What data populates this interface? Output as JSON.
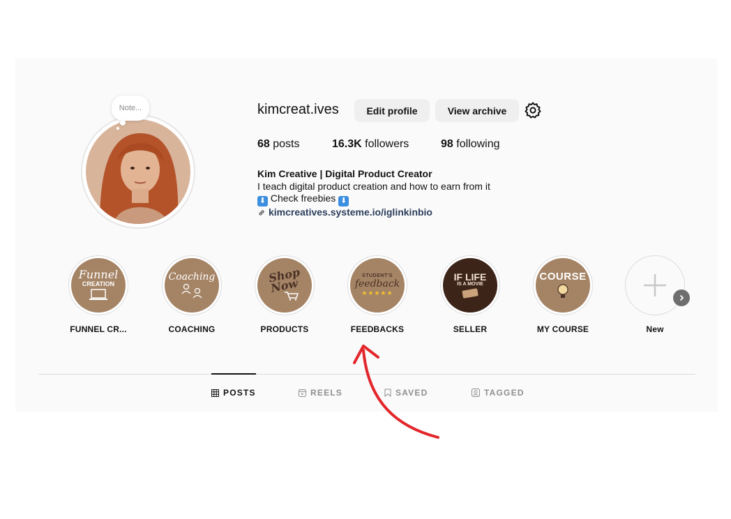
{
  "profile": {
    "note_placeholder": "Note...",
    "username": "kimcreat.ives",
    "edit_profile_label": "Edit profile",
    "view_archive_label": "View archive",
    "stats": {
      "posts_count": "68",
      "posts_label": "posts",
      "followers_count": "16.3K",
      "followers_label": "followers",
      "following_count": "98",
      "following_label": "following"
    },
    "bio": {
      "name": "Kim Creative | Digital Product Creator",
      "line1": "I teach digital product creation and how to earn from it",
      "line2": "Check freebies",
      "link": "kimcreatives.systeme.io/iglinkinbio"
    }
  },
  "highlights": [
    {
      "label": "FUNNEL CR...",
      "cover_text_1": "Funnel",
      "cover_text_2": "CREATION"
    },
    {
      "label": "COACHING",
      "cover_text_1": "Coaching"
    },
    {
      "label": "PRODUCTS",
      "cover_text_1": "Shop",
      "cover_text_2": "Now"
    },
    {
      "label": "FEEDBACKS",
      "cover_text_1": "STUDENT'S",
      "cover_text_2": "feedback"
    },
    {
      "label": "SELLER",
      "cover_text_1": "IF LIFE",
      "cover_text_2": "IS A MOVIE"
    },
    {
      "label": "MY COURSE",
      "cover_text_1": "COURSE"
    },
    {
      "label": "New"
    }
  ],
  "tabs": [
    {
      "label": "POSTS",
      "icon": "grid-icon",
      "active": true
    },
    {
      "label": "REELS",
      "icon": "reels-icon",
      "active": false
    },
    {
      "label": "SAVED",
      "icon": "bookmark-icon",
      "active": false
    },
    {
      "label": "TAGGED",
      "icon": "tag-person-icon",
      "active": false
    }
  ],
  "colors": {
    "highlight_cover": "#a58466",
    "annotation_arrow": "#e3262b",
    "link": "#2b3e5c"
  }
}
